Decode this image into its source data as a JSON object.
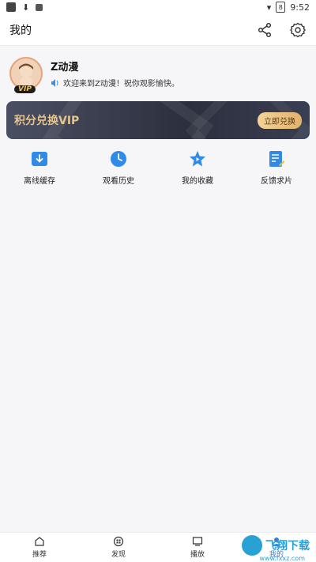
{
  "status_bar": {
    "left_icons": [
      "app-icon",
      "download-icon",
      "a-icon"
    ],
    "time": "9:52",
    "battery": "8"
  },
  "header": {
    "title": "我的",
    "share_icon": "share-icon",
    "settings_icon": "gear-icon"
  },
  "profile": {
    "username": "Z动漫",
    "welcome_text": "欢迎来到Z动漫！祝你观影愉快。",
    "vip_label": "VIP"
  },
  "vip_banner": {
    "title": "积分兑换VIP",
    "button_label": "立即兑换"
  },
  "features": [
    {
      "label": "离线缓存",
      "icon": "download-box-icon"
    },
    {
      "label": "观看历史",
      "icon": "clock-icon"
    },
    {
      "label": "我的收藏",
      "icon": "star-icon"
    },
    {
      "label": "反馈求片",
      "icon": "edit-doc-icon"
    }
  ],
  "bottom_nav": [
    {
      "label": "推荐",
      "icon": "home-icon"
    },
    {
      "label": "发现",
      "icon": "discover-icon"
    },
    {
      "label": "播放",
      "icon": "tv-icon"
    },
    {
      "label": "我的",
      "icon": "user-icon"
    }
  ],
  "colors": {
    "accent_blue": "#2f8ae8",
    "vip_gold": "#e6c38c",
    "banner_dark": "#2c2f3d"
  },
  "watermark": {
    "brand": "飞翔下载",
    "site": "www.fxxz.com"
  }
}
